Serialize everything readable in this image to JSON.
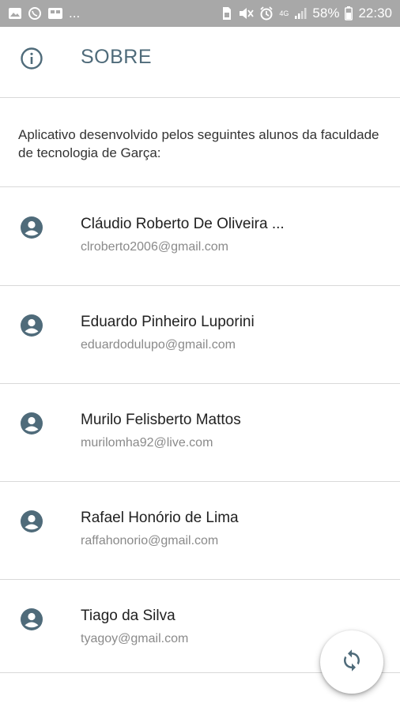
{
  "status_bar": {
    "left_icons": [
      "image-icon",
      "whatsapp-icon",
      "gallery-icon"
    ],
    "more": "...",
    "network": "4G",
    "battery": "58%",
    "time": "22:30"
  },
  "header": {
    "title": "SOBRE",
    "icon": "info-icon"
  },
  "intro": {
    "text": "Aplicativo desenvolvido pelos seguintes alunos da faculdade de tecnologia de Garça:"
  },
  "people": [
    {
      "name": "Cláudio Roberto De Oliveira ...",
      "email": "clroberto2006@gmail.com"
    },
    {
      "name": "Eduardo Pinheiro Luporini",
      "email": "eduardodulupo@gmail.com"
    },
    {
      "name": "Murilo Felisberto Mattos",
      "email": "murilomha92@live.com"
    },
    {
      "name": "Rafael Honório de Lima",
      "email": "raffahonorio@gmail.com"
    },
    {
      "name": "Tiago da Silva",
      "email": "tyagoy@gmail.com"
    }
  ],
  "fab": {
    "icon": "sync-icon"
  },
  "colors": {
    "accent": "#4f6b7a",
    "status_bar": "#a8a8a8",
    "divider": "#d9d9d9"
  }
}
